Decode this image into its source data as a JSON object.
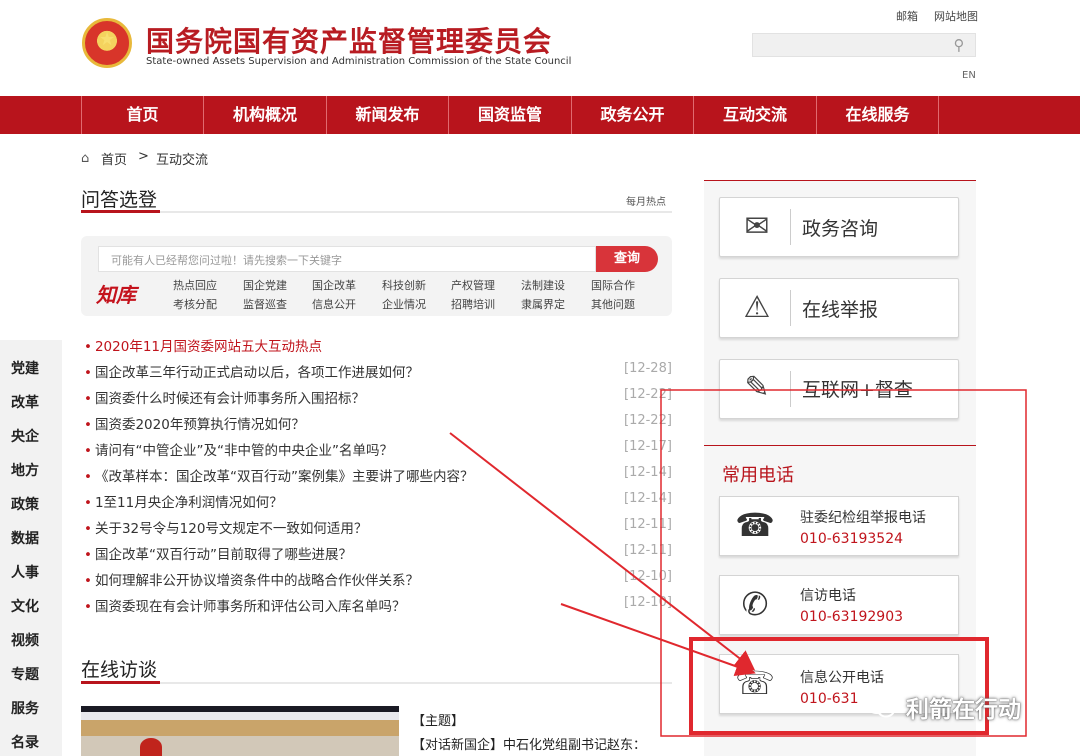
{
  "header": {
    "title": "国务院国有资产监督管理委员会",
    "subtitle": "State-owned Assets Supervision and Administration Commission of the State Council",
    "links": [
      "邮箱",
      "网站地图"
    ],
    "lang": "EN"
  },
  "nav": [
    "首页",
    "机构概况",
    "新闻发布",
    "国资监管",
    "政务公开",
    "互动交流",
    "在线服务"
  ],
  "breadcrumb": {
    "home": "首页",
    "sep": ">",
    "current": "互动交流"
  },
  "qa": {
    "title": "问答选登",
    "monthly_hot": "每月热点",
    "search_placeholder": "可能有人已经帮您问过啦！请先搜索一下关键字",
    "search_button": "查询",
    "logo": "知库",
    "tags_row1": [
      "热点回应",
      "国企党建",
      "国企改革",
      "科技创新",
      "产权管理",
      "法制建设",
      "国际合作"
    ],
    "tags_row2": [
      "考核分配",
      "监督巡查",
      "信息公开",
      "企业情况",
      "招聘培训",
      "隶属界定",
      "其他问题"
    ],
    "items": [
      {
        "text": "2020年11月国资委网站五大互动热点",
        "date": "",
        "hot": true
      },
      {
        "text": "国企改革三年行动正式启动以后，各项工作进展如何？",
        "date": "[12-28]"
      },
      {
        "text": "国资委什么时候还有会计师事务所入围招标？",
        "date": "[12-22]"
      },
      {
        "text": "国资委2020年预算执行情况如何？",
        "date": "[12-22]"
      },
      {
        "text": "请问有“中管企业”及“非中管的中央企业”名单吗？",
        "date": "[12-17]"
      },
      {
        "text": "《改革样本：国企改革“双百行动”案例集》主要讲了哪些内容？",
        "date": "[12-14]"
      },
      {
        "text": "1至11月央企净利润情况如何？",
        "date": "[12-14]"
      },
      {
        "text": "关于32号令与120号文规定不一致如何适用？",
        "date": "[12-11]"
      },
      {
        "text": "国企改革“双百行动”目前取得了哪些进展？",
        "date": "[12-11]"
      },
      {
        "text": "如何理解非公开协议增资条件中的战略合作伙伴关系？",
        "date": "[12-10]"
      },
      {
        "text": "国资委现在有会计师事务所和评估公司入库名单吗？",
        "date": "[12-10]"
      }
    ]
  },
  "left_tabs": [
    "党建",
    "改革",
    "央企",
    "地方",
    "政策",
    "数据",
    "人事",
    "文化",
    "视频",
    "专题",
    "服务",
    "名录"
  ],
  "interview": {
    "title": "在线访谈",
    "topic_head": "【主题】",
    "topic_text": "【对话新国企】中石化党组副书记赵东："
  },
  "right": {
    "buttons": [
      {
        "label": "政务咨询",
        "icon": "mail-icon"
      },
      {
        "label": "在线举报",
        "icon": "warning-icon"
      },
      {
        "label": "互联网+督查",
        "icon": "edit-icon"
      }
    ],
    "phone_title": "常用电话",
    "phones": [
      {
        "label": "驻委纪检组举报电话",
        "number": "010-63193524"
      },
      {
        "label": "信访电话",
        "number": "010-63192903"
      },
      {
        "label": "信息公开电话",
        "number": "010-631"
      }
    ]
  },
  "watermark": "利箭在行动",
  "colors": {
    "brand_red": "#b8141c",
    "annotation_red": "#e0282e"
  }
}
